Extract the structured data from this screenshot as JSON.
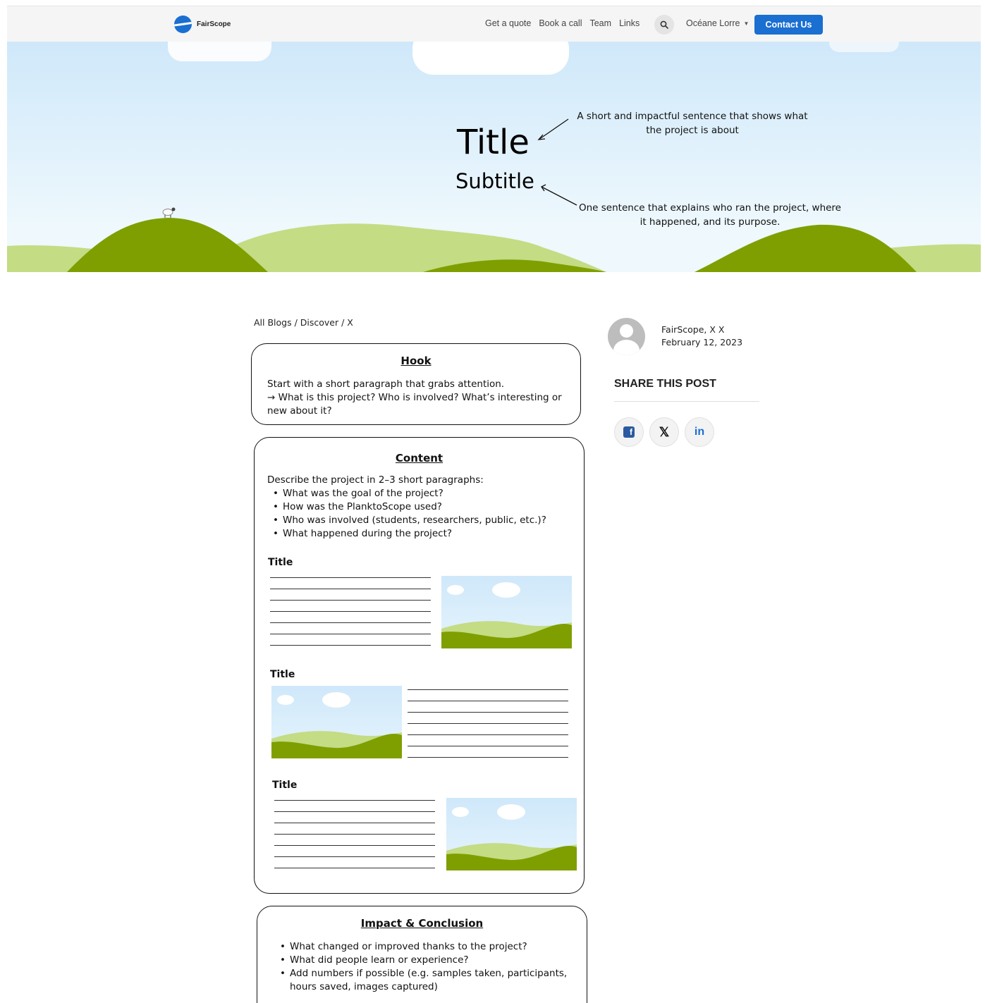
{
  "nav": {
    "brand": "FairScope",
    "links": [
      "Get a quote",
      "Book a call",
      "Team",
      "Links"
    ],
    "user": "Océane Lorre",
    "contact": "Contact Us"
  },
  "hero": {
    "title": "Title",
    "subtitle": "Subtitle",
    "title_note": "A short and impactful sentence that shows what the project is about",
    "subtitle_note": "One sentence that explains who ran the project, where it happened, and its purpose."
  },
  "breadcrumb": "All Blogs / Discover / X",
  "hook": {
    "title": "Hook",
    "line1": "Start with a short paragraph that grabs attention.",
    "line2": "→ What is this project? Who is involved? What’s interesting or new about it?"
  },
  "content": {
    "title": "Content",
    "intro": "Describe the project in 2–3 short paragraphs:",
    "bullets": [
      "What was the goal of the project?",
      "How was the PlanktoScope used?",
      "Who was involved (students, researchers, public, etc.)?",
      "What happened during the project?"
    ],
    "sections": [
      "Title",
      "Title",
      "Title"
    ]
  },
  "impact": {
    "title": "Impact & Conclusion",
    "bullets": [
      "What changed or improved thanks to the project?",
      "What did people learn or experience?",
      "Add numbers if possible (e.g. samples taken, participants, hours saved, images captured)"
    ]
  },
  "author": {
    "name": "FairScope, X X",
    "date": "February 12, 2023"
  },
  "share": {
    "title": "SHARE THIS POST",
    "facebook_glyph": "f",
    "x_glyph": "𝕏",
    "linkedin_glyph": "in"
  },
  "colors": {
    "accent": "#1a6fd1",
    "hill_dark": "#7f9f00",
    "hill_light": "#c4dc84",
    "sky": "#cfe8fa"
  }
}
